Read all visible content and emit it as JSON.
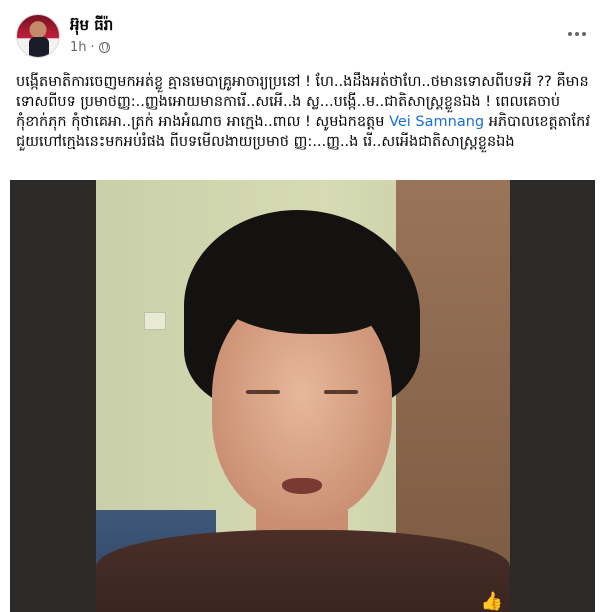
{
  "post": {
    "author": "អ៊ុម ធីរ៉ា",
    "time": "1h",
    "separator": "·",
    "privacy_icon": "globe-icon",
    "more_icon": "more-options-icon",
    "caption": {
      "part1": "បង្កើតមាតិការចេញមកអត់ខ្លួ គ្មានមេបាគ្រូអាចារ្យប្រនៅ ! ហែ..ងដឹងអត់ថាហែ..ថមានទោសពីបទអី ?? គឺមានទោសពីបទ ប្រមាថញ្ញ:..ញ្ញងអោយមានការើ..សអើ..ង ស្ល...បង្កើ..ម..ជាតិសាស្រ្តខ្លួនឯង ! ពេលគេចាប់កុំខាក់ភុក កុំថាគេអា..ត្រក់ អាងអំណាច អាក្មេង..ពាល ! សូមឯកឧត្តម ",
      "mention": "Vei Samnang",
      "part2": " អភិបាលខេត្តតាកែវ ជួយហៅក្មេងនេះមកអប់រំផង ពីបទមើលងាយប្រមាថ ញ្ញ:...ញ្ញ..ង រើ..សអើងជាតិសាស្រ្តខ្លួនឯង"
    },
    "video_overlay_icon": "thumbs-up-icon"
  },
  "colors": {
    "mention": "#1a6ed8",
    "meta_text": "#65676b"
  }
}
